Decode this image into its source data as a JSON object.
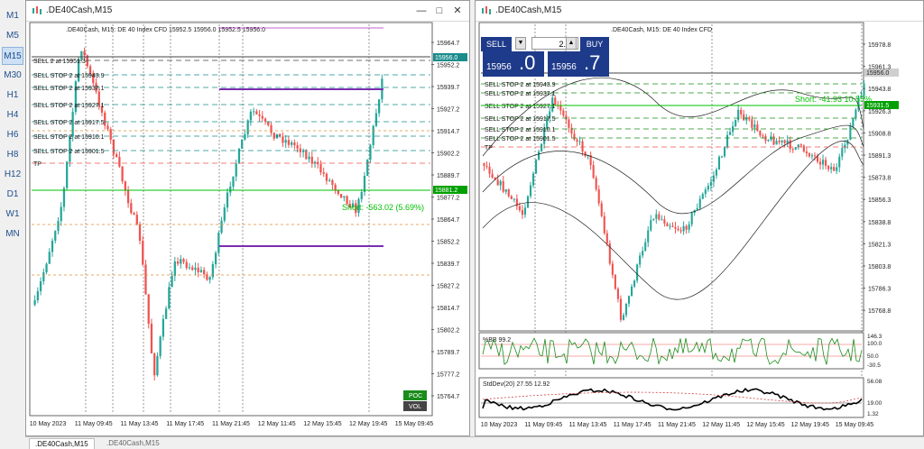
{
  "timeframes": [
    "M1",
    "M5",
    "M15",
    "M30",
    "H1",
    "H4",
    "H6",
    "H8",
    "H12",
    "D1",
    "W1",
    "MN"
  ],
  "active_timeframe": "M15",
  "left_window": {
    "title": ".DE40Cash,M15",
    "symbol_line": ".DE40Cash, M15:  DE 40 Index CFD   15952.5 15956.0 15952.5 15956.0",
    "price_labels": [
      "15964.7",
      "15952.2",
      "15939.7",
      "15927.2",
      "15914.7",
      "15902.2",
      "15889.7",
      "15877.2",
      "15864.7",
      "15852.2",
      "15839.7",
      "15827.2",
      "15814.7",
      "15802.2",
      "15789.7",
      "15777.2",
      "15764.7"
    ],
    "current_price": "15956.0",
    "green_price": "15881.2",
    "orders": [
      "SELL 2 at 15951.3",
      "SELL STOP 2 at 15943.9",
      "SELL STOP 2 at 15937.1",
      "SELL STOP 2 at 15927.1",
      "SELL STOP 2 at 15917.5",
      "SELL STOP 2 at 15910.1",
      "SELL STOP 2 at 15901.5",
      "TP"
    ],
    "profit_text": "Short: -563.02  (5.69%)",
    "time_labels": [
      "10 May 2023",
      "11 May 09:45",
      "11 May 13:45",
      "11 May 17:45",
      "11 May 21:45",
      "12 May 11:45",
      "12 May 15:45",
      "12 May 19:45",
      "15 May 09:45"
    ],
    "poc_label": "POC",
    "vol_label": "VOL"
  },
  "right_window": {
    "title": ".DE40Cash,M15",
    "symbol_line": ".DE40Cash, M15:  DE 40 Index CFD",
    "sell_label": "SELL",
    "buy_label": "BUY",
    "volume": "2.00",
    "sell_small": "15956",
    "sell_big": ".0",
    "buy_small": "15956",
    "buy_big": ".7",
    "price_labels": [
      "15978.8",
      "15961.3",
      "15943.8",
      "15926.3",
      "15908.8",
      "15891.3",
      "15873.8",
      "15856.3",
      "15838.8",
      "15821.3",
      "15803.8",
      "15786.3",
      "15768.8"
    ],
    "current_price": "15956.0",
    "green_price": "15931.5",
    "profit_text": "Short: -41.93  10.55%",
    "orders": [
      "SELL STOP 2 at 15943.9",
      "SELL STOP 2 at 15937.1",
      "SELL STOP 2 at 15927.1",
      "SELL STOP 2 at 15917.5",
      "SELL STOP 2 at 15910.1",
      "SELL STOP 2 at 15901.5",
      "TP"
    ],
    "bb_label": "%BB 99.2",
    "bb_scale": [
      "146.3",
      "100.0",
      "50.0",
      "-30.5"
    ],
    "std_label": "StdDev(20) 27.55 12.92",
    "std_scale": [
      "56.08",
      "19.00",
      "1.32"
    ],
    "time_labels": [
      "10 May 2023",
      "11 May 09:45",
      "11 May 13:45",
      "11 May 17:45",
      "11 May 21:45",
      "12 May 11:45",
      "12 May 15:45",
      "12 May 19:45",
      "15 May 09:45"
    ]
  },
  "tabs": [
    ".DE40Cash,M15",
    ".DE40Cash,M15"
  ],
  "colors": {
    "bull": "#26a69a",
    "bear": "#ef5350",
    "green_line": "#00c000",
    "purple": "#7a2fb0",
    "orange": "#e09030",
    "dark_blue": "#1e3a8a"
  }
}
